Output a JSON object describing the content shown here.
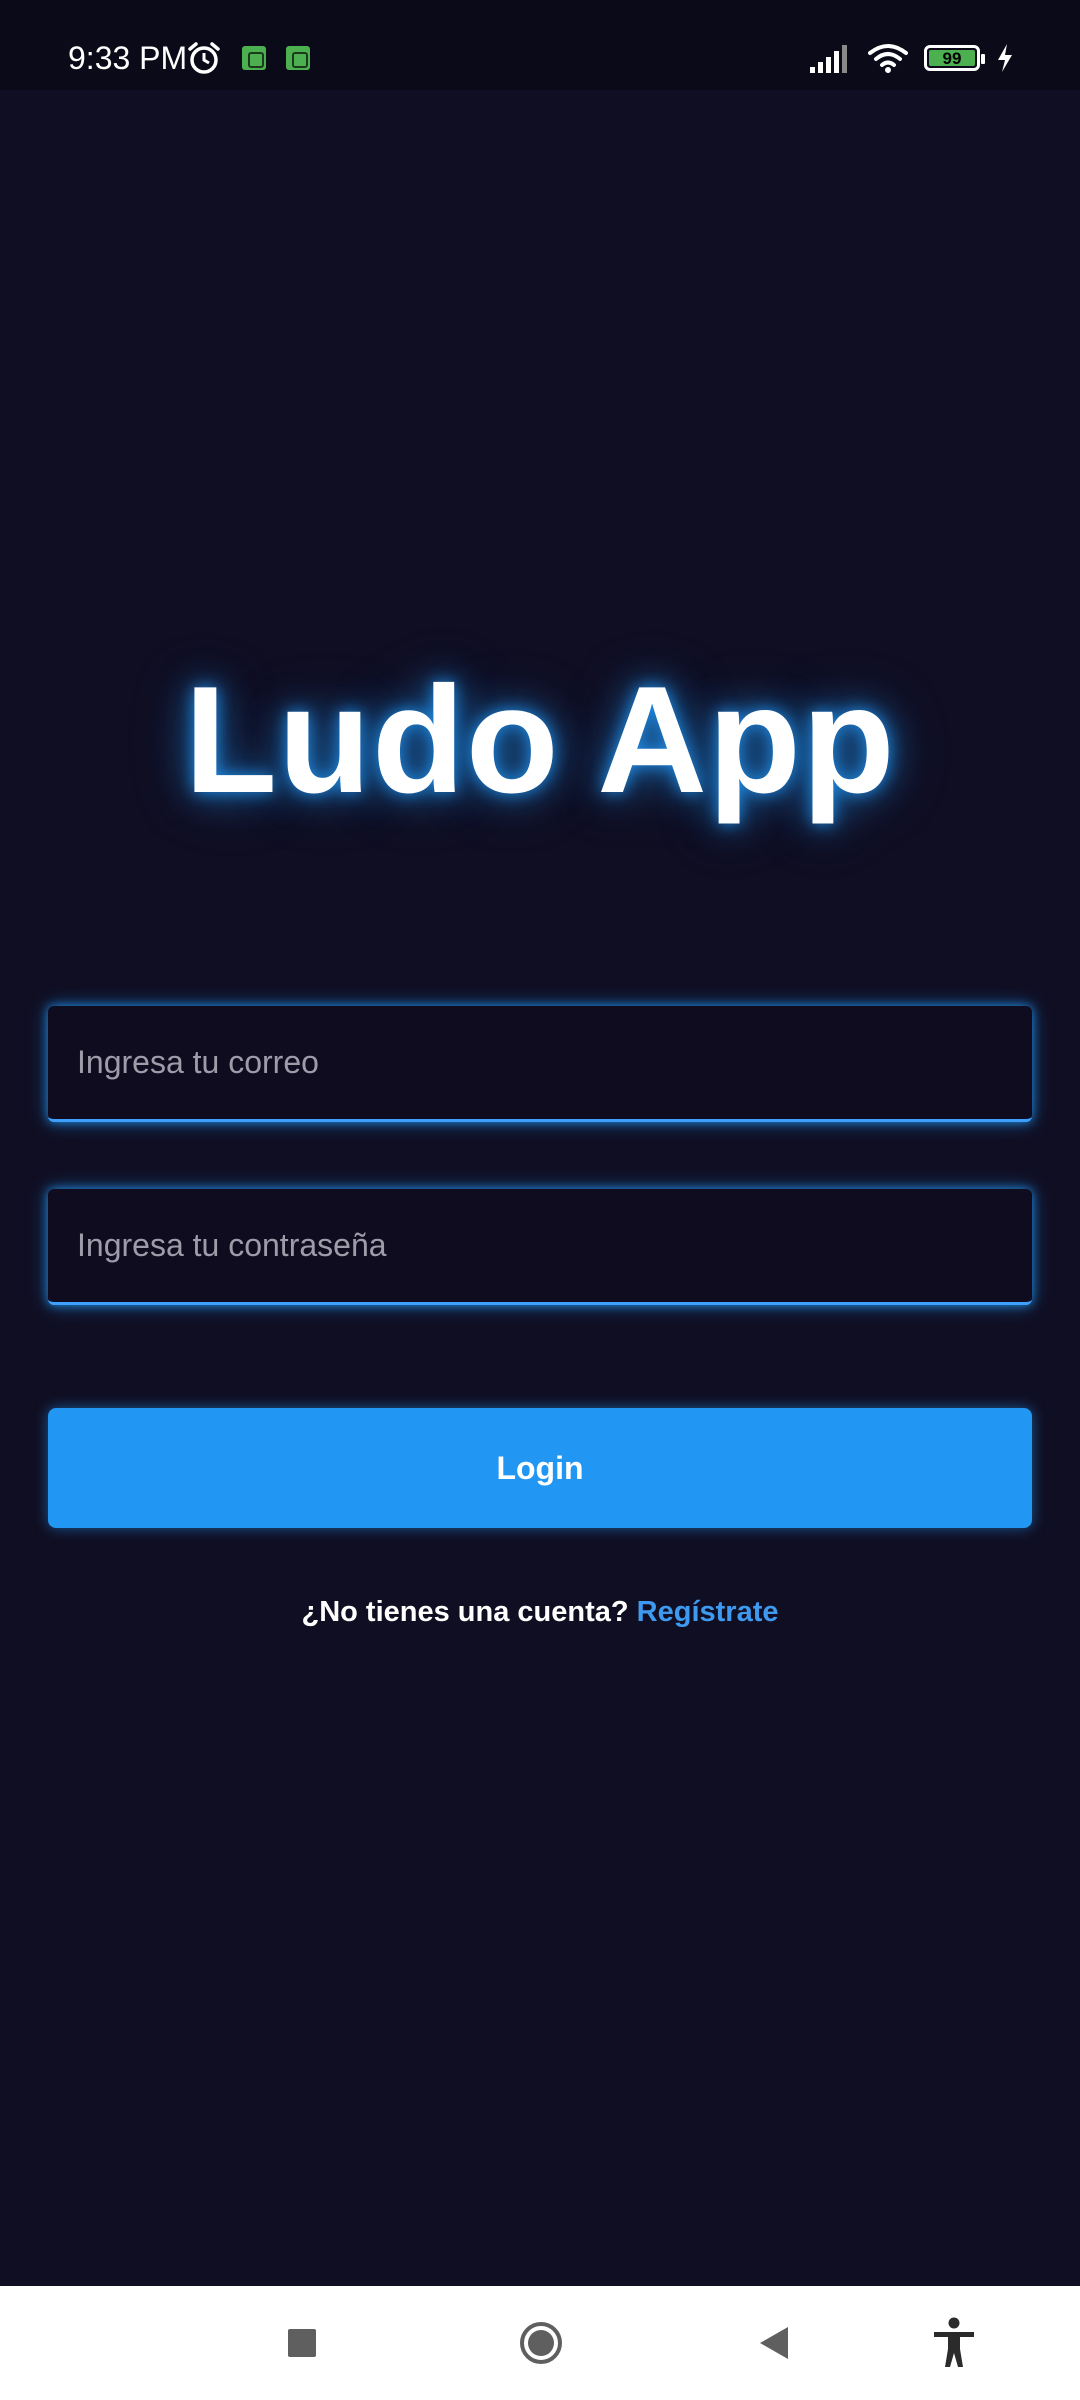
{
  "status_bar": {
    "time": "9:33 PM",
    "battery_level": "99",
    "battery_fraction": 0.99,
    "icons": [
      "alarm-icon",
      "app-notification-icon",
      "app-notification-icon",
      "signal-icon",
      "wifi-icon",
      "battery-icon",
      "charging-icon"
    ]
  },
  "app": {
    "title": "Ludo App"
  },
  "form": {
    "email_placeholder": "Ingresa tu correo",
    "email_value": "",
    "password_placeholder": "Ingresa tu contraseña",
    "password_value": "",
    "login_label": "Login",
    "signup_prompt": "¿No tienes una cuenta?",
    "signup_link": "Regístrate"
  },
  "nav_bar": {
    "icons": [
      "recents-icon",
      "home-icon",
      "back-icon",
      "accessibility-icon"
    ]
  },
  "colors": {
    "background": "#100e22",
    "accent": "#2196f3",
    "link": "#3d9af0",
    "title_glow": "#2196f3",
    "nav_background": "#ffffff"
  }
}
